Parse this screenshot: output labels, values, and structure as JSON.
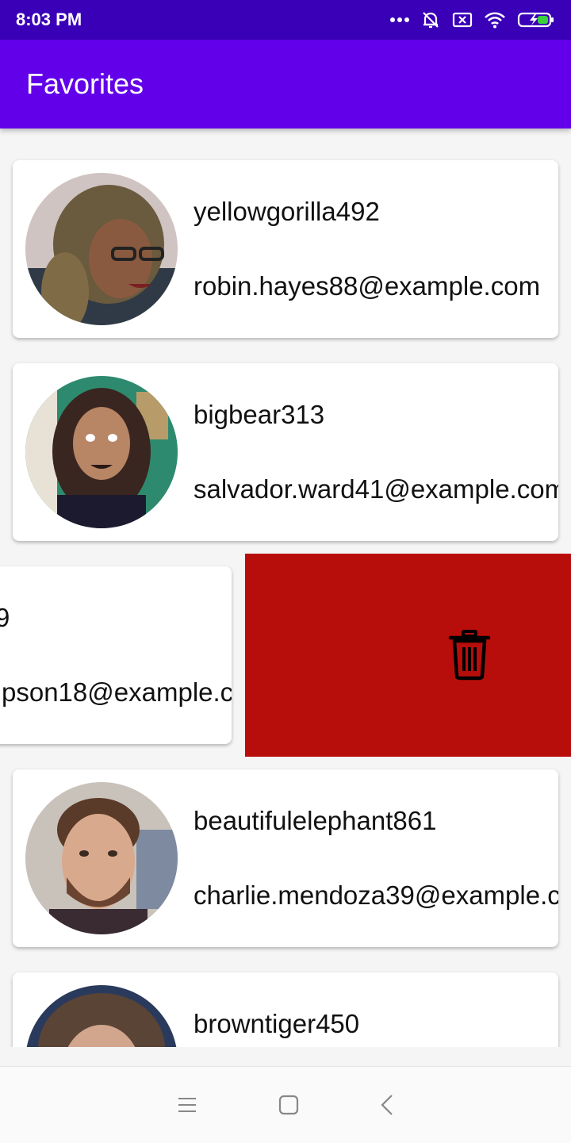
{
  "status_bar": {
    "time": "8:03 PM",
    "icons": [
      "more-dots-icon",
      "bell-off-icon",
      "sim-x-icon",
      "wifi-icon",
      "battery-charging-icon"
    ]
  },
  "app_bar": {
    "title": "Favorites"
  },
  "favorites": [
    {
      "username": "yellowgorilla492",
      "email": "robin.hayes88@example.com"
    },
    {
      "username": "bigbear313",
      "email": "salvador.ward41@example.com"
    },
    {
      "username": "9",
      "email": "pson18@example.c",
      "swiped": true
    },
    {
      "username": "beautifulelephant861",
      "email": "charlie.mendoza39@example.c"
    },
    {
      "username": "browntiger450",
      "email": ""
    }
  ],
  "delete_action": {
    "icon": "trash-icon",
    "color": "#b80e0b"
  },
  "colors": {
    "status_bar": "#3a00b8",
    "app_bar": "#6200ea",
    "delete": "#b80e0b"
  },
  "nav_bar": {
    "icons": [
      "menu-icon",
      "home-square-icon",
      "back-icon"
    ]
  }
}
